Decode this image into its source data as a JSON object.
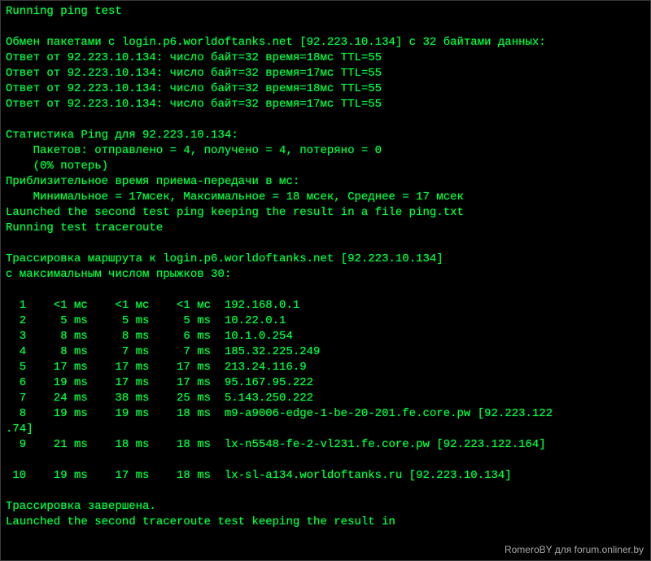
{
  "watermark": "RomeroBY для forum.onliner.by",
  "lines": [
    "Running ping test",
    "",
    "Обмен пакетами с login.p6.worldoftanks.net [92.223.10.134] с 32 байтами данных:",
    "Ответ от 92.223.10.134: число байт=32 время=18мс TTL=55",
    "Ответ от 92.223.10.134: число байт=32 время=17мс TTL=55",
    "Ответ от 92.223.10.134: число байт=32 время=18мс TTL=55",
    "Ответ от 92.223.10.134: число байт=32 время=17мс TTL=55",
    "",
    "Статистика Ping для 92.223.10.134:",
    "    Пакетов: отправлено = 4, получено = 4, потеряно = 0",
    "    (0% потерь)",
    "Приблизительное время приема-передачи в мс:",
    "    Минимальное = 17мсек, Максимальное = 18 мсек, Среднее = 17 мсек",
    "Launched the second test ping keeping the result in a file ping.txt",
    "Running test traceroute",
    "",
    "Трассировка маршрута к login.p6.worldoftanks.net [92.223.10.134]",
    "с максимальным числом прыжков 30:",
    "",
    "  1    <1 мс    <1 мс    <1 мс  192.168.0.1",
    "  2     5 ms     5 ms     5 ms  10.22.0.1",
    "  3     8 ms     8 ms     6 ms  10.1.0.254",
    "  4     8 ms     7 ms     7 ms  185.32.225.249",
    "  5    17 ms    17 ms    17 ms  213.24.116.9",
    "  6    19 ms    17 ms    17 ms  95.167.95.222",
    "  7    24 ms    38 ms    25 ms  5.143.250.222",
    "  8    19 ms    19 ms    18 ms  m9-a9006-edge-1-be-20-201.fe.core.pw [92.223.122",
    ".74]",
    "  9    21 ms    18 ms    18 ms  lx-n5548-fe-2-vl231.fe.core.pw [92.223.122.164]",
    "",
    " 10    19 ms    17 ms    18 ms  lx-sl-a134.worldoftanks.ru [92.223.10.134]",
    "",
    "Трассировка завершена.",
    "Launched the second traceroute test keeping the result in"
  ],
  "ping": {
    "host": "login.p6.worldoftanks.net",
    "ip": "92.223.10.134",
    "bytes": 32,
    "replies": [
      {
        "bytes": 32,
        "time_ms": 18,
        "ttl": 55
      },
      {
        "bytes": 32,
        "time_ms": 17,
        "ttl": 55
      },
      {
        "bytes": 32,
        "time_ms": 18,
        "ttl": 55
      },
      {
        "bytes": 32,
        "time_ms": 17,
        "ttl": 55
      }
    ],
    "stats": {
      "sent": 4,
      "received": 4,
      "lost": 0,
      "loss_pct": 0,
      "min_ms": 17,
      "max_ms": 18,
      "avg_ms": 17
    }
  },
  "traceroute": {
    "target_host": "login.p6.worldoftanks.net",
    "target_ip": "92.223.10.134",
    "max_hops": 30,
    "hops": [
      {
        "n": 1,
        "t1": "<1 мс",
        "t2": "<1 мс",
        "t3": "<1 мс",
        "host": "192.168.0.1"
      },
      {
        "n": 2,
        "t1": "5 ms",
        "t2": "5 ms",
        "t3": "5 ms",
        "host": "10.22.0.1"
      },
      {
        "n": 3,
        "t1": "8 ms",
        "t2": "8 ms",
        "t3": "6 ms",
        "host": "10.1.0.254"
      },
      {
        "n": 4,
        "t1": "8 ms",
        "t2": "7 ms",
        "t3": "7 ms",
        "host": "185.32.225.249"
      },
      {
        "n": 5,
        "t1": "17 ms",
        "t2": "17 ms",
        "t3": "17 ms",
        "host": "213.24.116.9"
      },
      {
        "n": 6,
        "t1": "19 ms",
        "t2": "17 ms",
        "t3": "17 ms",
        "host": "95.167.95.222"
      },
      {
        "n": 7,
        "t1": "24 ms",
        "t2": "38 ms",
        "t3": "25 ms",
        "host": "5.143.250.222"
      },
      {
        "n": 8,
        "t1": "19 ms",
        "t2": "19 ms",
        "t3": "18 ms",
        "host": "m9-a9006-edge-1-be-20-201.fe.core.pw",
        "ip": "92.223.122.74"
      },
      {
        "n": 9,
        "t1": "21 ms",
        "t2": "18 ms",
        "t3": "18 ms",
        "host": "lx-n5548-fe-2-vl231.fe.core.pw",
        "ip": "92.223.122.164"
      },
      {
        "n": 10,
        "t1": "19 ms",
        "t2": "17 ms",
        "t3": "18 ms",
        "host": "lx-sl-a134.worldoftanks.ru",
        "ip": "92.223.10.134"
      }
    ],
    "complete_msg": "Трассировка завершена."
  }
}
